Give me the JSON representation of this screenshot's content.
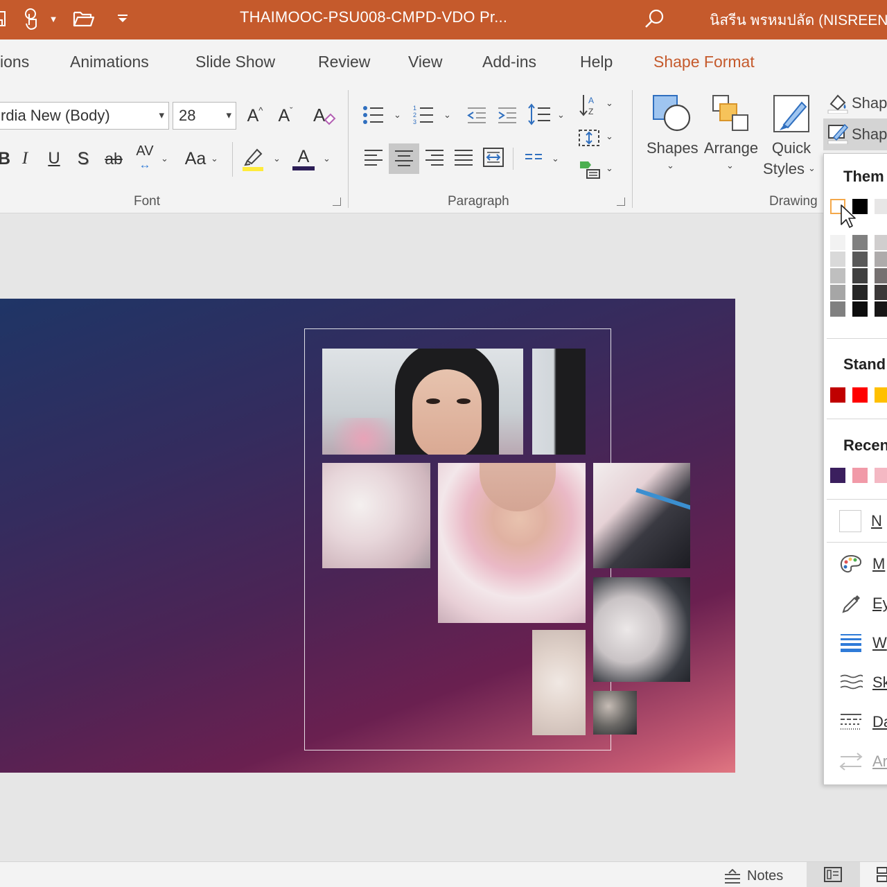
{
  "titlebar": {
    "title": "THAIMOOC-PSU008-CMPD-VDO Pr...",
    "user": "นิสรีน พรหมปลัด (NISREEN",
    "icons": [
      "save-icon",
      "touch-mode-icon",
      "open-folder-icon",
      "customize-qat-icon",
      "search-icon"
    ]
  },
  "tabs": [
    {
      "label": "ions"
    },
    {
      "label": "Animations"
    },
    {
      "label": "Slide Show"
    },
    {
      "label": "Review"
    },
    {
      "label": "View"
    },
    {
      "label": "Add-ins"
    },
    {
      "label": "Help"
    },
    {
      "label": "Shape Format",
      "active": true
    }
  ],
  "ribbon": {
    "font": {
      "name": "rdia New (Body)",
      "size": "28",
      "label": "Font",
      "grow_label": "A",
      "shrink_label": "A",
      "italic": "I",
      "underline": "U",
      "shadow": "S",
      "strike": "ab",
      "spacing": "AV",
      "case": "Aa",
      "color_letter": "A"
    },
    "paragraph": {
      "label": "Paragraph"
    },
    "drawing": {
      "label": "Drawing",
      "shapes": "Shapes",
      "arrange": "Arrange",
      "quick_1": "Quick",
      "quick_2": "Styles",
      "shape_fill": "Shap",
      "shape_outline": "Shap"
    }
  },
  "color_panel": {
    "theme_title": "Them",
    "standard_title": "Stand",
    "recent_title": "Recen",
    "no_outline": "N",
    "more_colors": "M",
    "eyedropper": "Ey",
    "weight": "W",
    "sketched": "Sk",
    "dashes": "Da",
    "arrows": "Ar",
    "theme_top_colors": [
      "#ffffff",
      "#000000",
      "#e7e6e6"
    ],
    "theme_shades": [
      [
        "#f2f2f2",
        "#d9d9d9",
        "#bfbfbf",
        "#a6a6a6",
        "#808080"
      ],
      [
        "#808080",
        "#595959",
        "#404040",
        "#262626",
        "#0d0d0d"
      ],
      [
        "#d0cece",
        "#aeabab",
        "#767171",
        "#3b3838",
        "#171616"
      ]
    ],
    "standard_colors": [
      "#c00000",
      "#ff0000",
      "#ffc000"
    ],
    "recent_colors": [
      "#3b1f5e",
      "#f19aa8",
      "#f4b8c3"
    ]
  },
  "statusbar": {
    "notes": "Notes"
  }
}
